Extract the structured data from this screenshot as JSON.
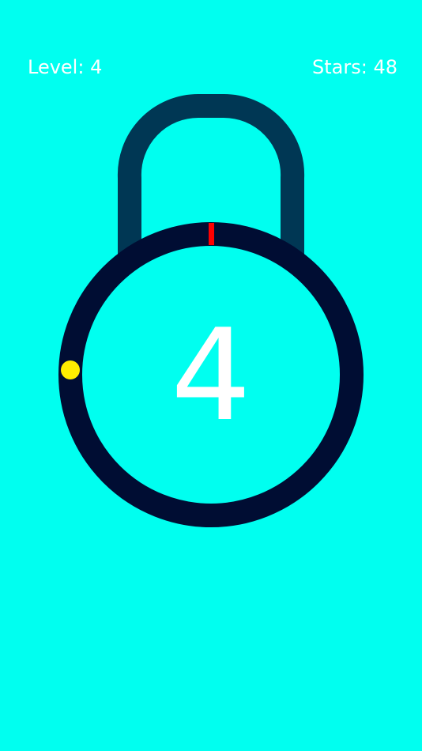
{
  "hud": {
    "level_label": "Level:",
    "level_value": "4",
    "stars_label": "Stars:",
    "stars_value": "48"
  },
  "lock": {
    "remaining": "4",
    "target_dot_angle_deg": 268,
    "needle_angle_deg": 0
  },
  "colors": {
    "background": "#00FFF0",
    "shackle": "#003754",
    "ring": "#000D33",
    "needle": "#FF0000",
    "target_dot": "#FFEE00",
    "text": "#FFFFFF"
  }
}
